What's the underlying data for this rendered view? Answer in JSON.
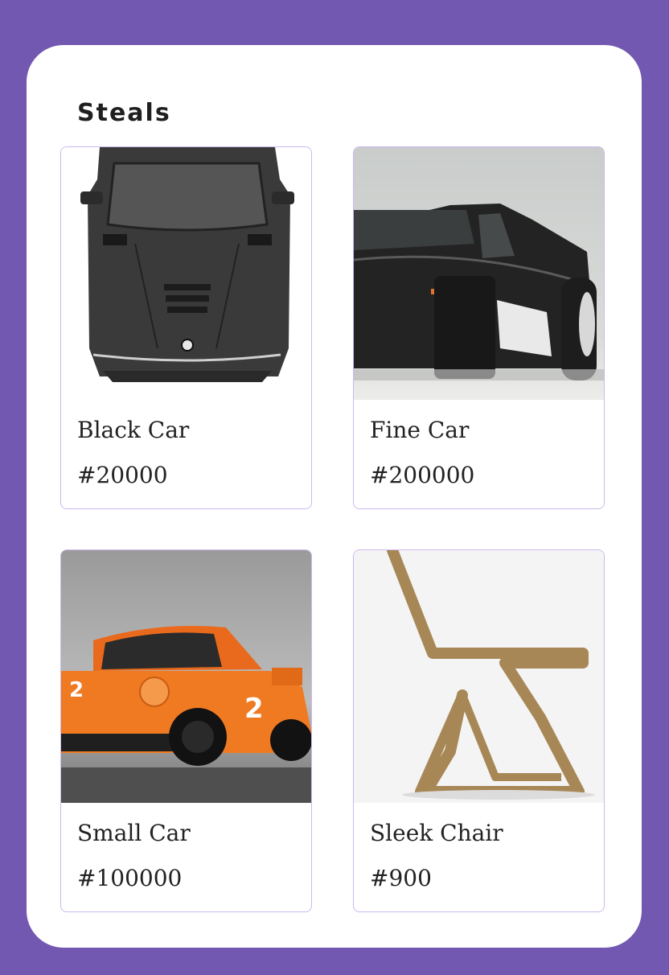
{
  "page": {
    "title": "Steals",
    "colors": {
      "background": "#7258b0",
      "panel": "#ffffff",
      "card_border": "#cbb8ee"
    }
  },
  "products": [
    {
      "name": "Black Car",
      "price": "#20000",
      "image": "black-car-image"
    },
    {
      "name": "Fine Car",
      "price": "#200000",
      "image": "fine-car-image"
    },
    {
      "name": "Small Car",
      "price": "#100000",
      "image": "small-car-image"
    },
    {
      "name": "Sleek Chair",
      "price": "#900",
      "image": "sleek-chair-image"
    }
  ]
}
